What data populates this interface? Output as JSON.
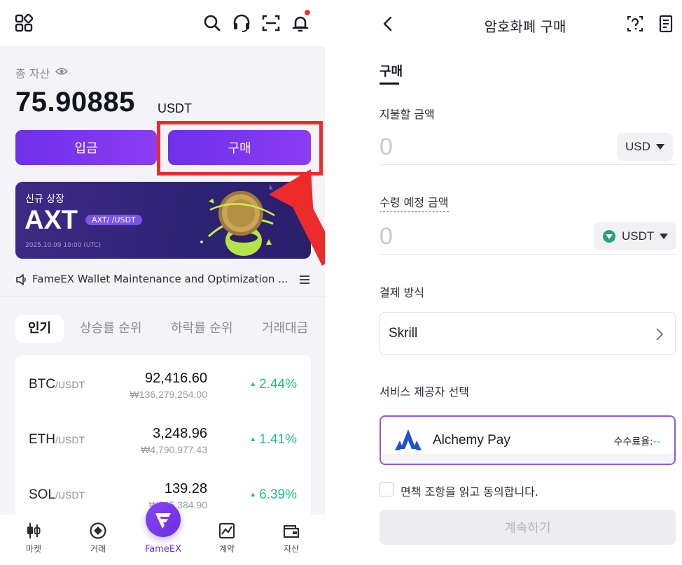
{
  "left": {
    "topbar": {
      "icons": [
        "apps-icon",
        "search-icon",
        "headset-icon",
        "scan-icon",
        "bell-icon"
      ]
    },
    "asset": {
      "label": "총 자산",
      "balance": "75.90885",
      "unit": "USDT"
    },
    "buttons": {
      "deposit": "입금",
      "buy": "구매"
    },
    "banner": {
      "tag": "신규 상장",
      "coin": "AXT",
      "pair": "AXT/ /USDT",
      "date": "2025.10.09 10:00 (UTC)"
    },
    "notice": {
      "text": "FameEX Wallet Maintenance and Optimization ..."
    },
    "tabs": [
      "인기",
      "상승률 순위",
      "하락률 순위",
      "거래대금"
    ],
    "market": [
      {
        "symbol": "BTC",
        "quote": "/USDT",
        "price": "92,416.60",
        "krw": "₩136,279,254.00",
        "change": "2.44%"
      },
      {
        "symbol": "ETH",
        "quote": "/USDT",
        "price": "3,248.96",
        "krw": "₩4,790,977.43",
        "change": "1.41%"
      },
      {
        "symbol": "SOL",
        "quote": "/USDT",
        "price": "139.28",
        "krw": "₩205,384.90",
        "change": "6.39%"
      }
    ],
    "nav": {
      "market": "마켓",
      "trade": "거래",
      "center": "FameEX",
      "futures": "계약",
      "assets": "자산"
    }
  },
  "right": {
    "title": "암호화폐 구매",
    "tab": "구매",
    "pay": {
      "label": "지불할 금액",
      "value": "0",
      "currency": "USD"
    },
    "receive": {
      "label": "수령 예정 금액",
      "value": "0",
      "currency": "USDT"
    },
    "method": {
      "label": "결제 방식",
      "value": "Skrill"
    },
    "provider": {
      "label": "서비스 제공자 선택",
      "name": "Alchemy Pay",
      "fee_label": "수수료율:",
      "fee_value": "--"
    },
    "agree": "면책 조항을 읽고 동의합니다.",
    "continue": "계속하기"
  },
  "colors": {
    "accent": "#7b3cf0",
    "highlight": "#ee2b2b",
    "positive": "#1fbf86"
  }
}
